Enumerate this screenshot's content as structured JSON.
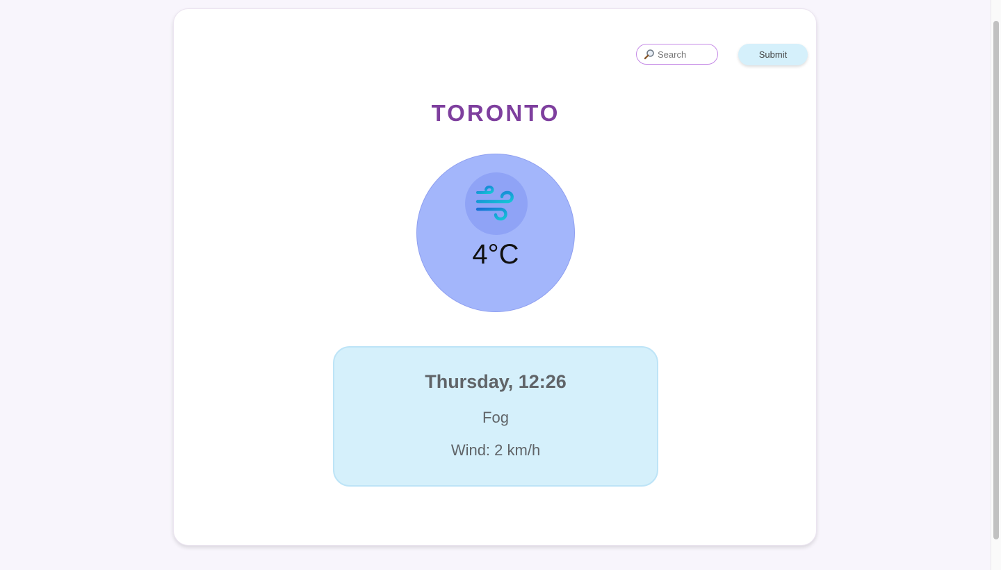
{
  "search": {
    "placeholder": "Search",
    "icon": "magnifier-icon"
  },
  "submit_label": "Submit",
  "weather": {
    "city": "TORONTO",
    "icon": "wind-icon",
    "temperature": "4°C",
    "date_time": "Thursday, 12:26",
    "condition": "Fog",
    "wind": "Wind: 2 km/h"
  },
  "colors": {
    "page_background": "#f8f5fc",
    "city_title": "#7e3f9e",
    "circle": "#a3b6fb",
    "details_background": "#d5f0fb",
    "submit_background": "#d5f0fb",
    "search_border": "#c58ae6"
  }
}
